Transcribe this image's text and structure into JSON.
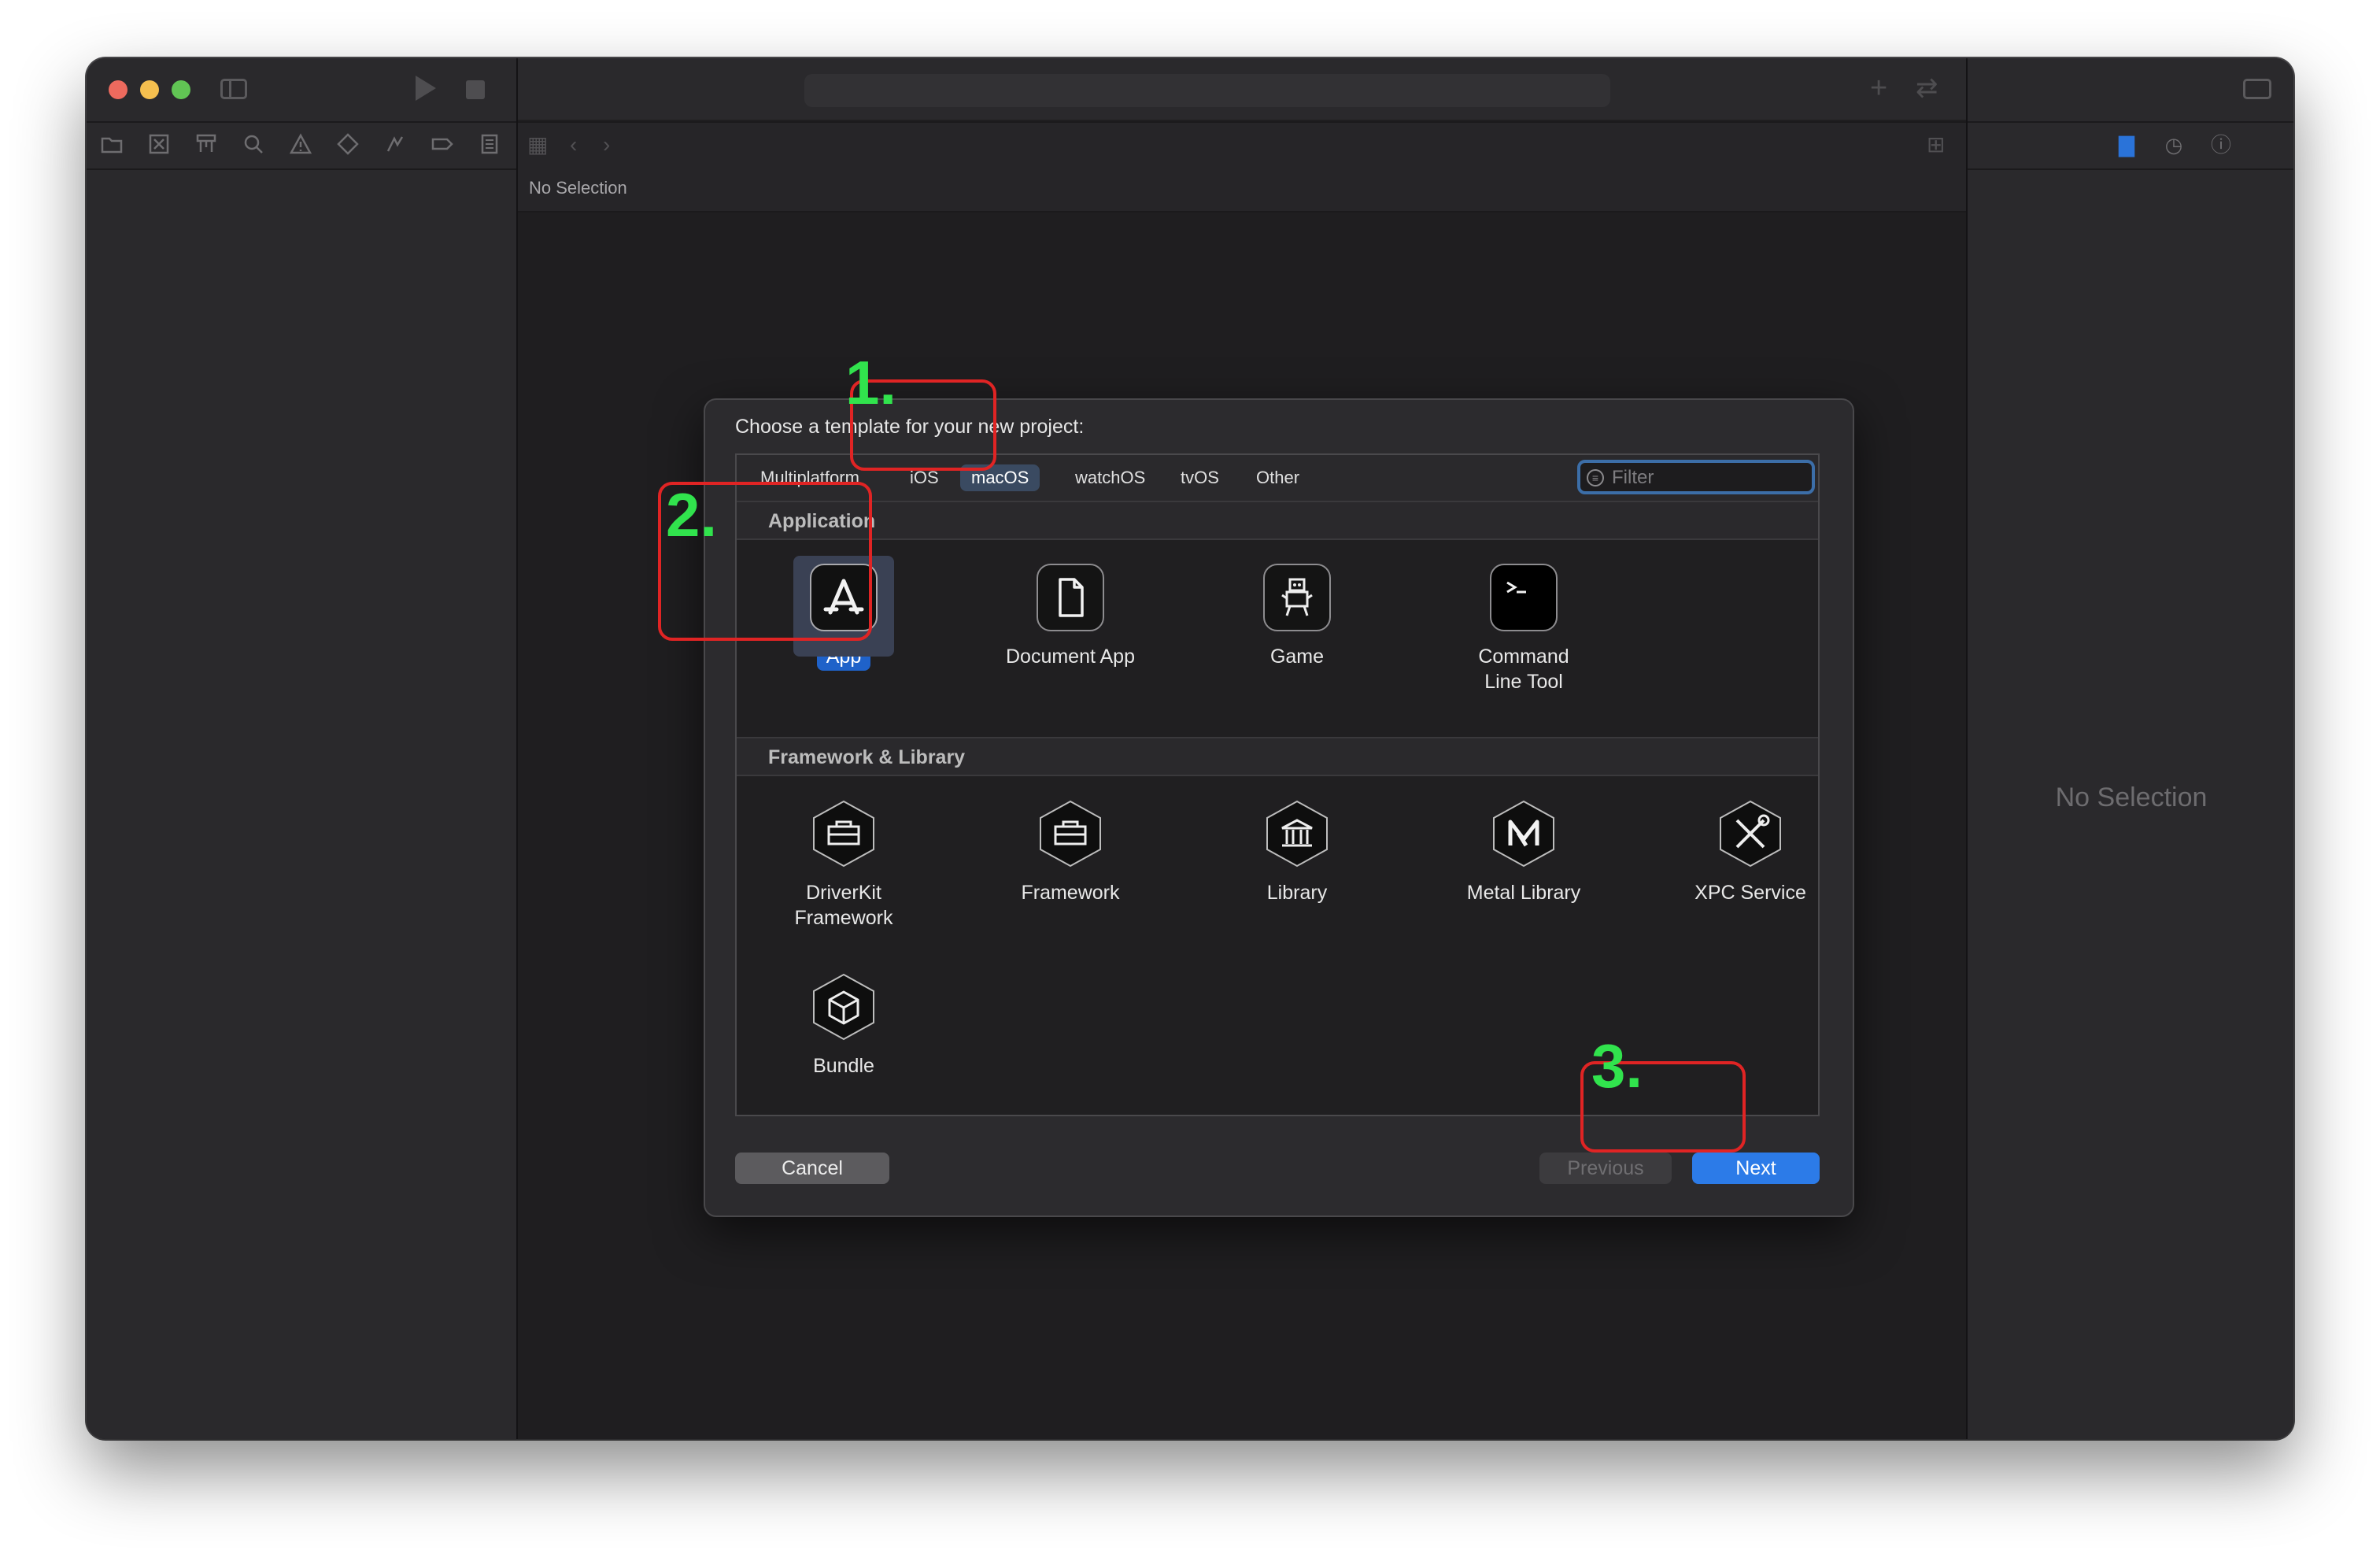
{
  "window": {
    "editor_path": "No Selection",
    "inspector_empty": "No Selection"
  },
  "dialog": {
    "title": "Choose a template for your new project:",
    "tabs": [
      {
        "label": "Multiplatform",
        "active": false
      },
      {
        "label": "iOS",
        "active": false
      },
      {
        "label": "macOS",
        "active": true
      },
      {
        "label": "watchOS",
        "active": false
      },
      {
        "label": "tvOS",
        "active": false
      },
      {
        "label": "Other",
        "active": false
      }
    ],
    "filter_placeholder": "Filter",
    "sections": [
      {
        "header": "Application",
        "templates": [
          {
            "label": "App",
            "icon": "app-store-a-icon",
            "selected": true
          },
          {
            "label": "Document App",
            "icon": "document-icon",
            "selected": false
          },
          {
            "label": "Game",
            "icon": "game-robot-icon",
            "selected": false
          },
          {
            "label": "Command\nLine Tool",
            "icon": "terminal-icon",
            "selected": false
          }
        ]
      },
      {
        "header": "Framework & Library",
        "templates": [
          {
            "label": "DriverKit\nFramework",
            "icon": "toolbox-icon"
          },
          {
            "label": "Framework",
            "icon": "toolbox-icon"
          },
          {
            "label": "Library",
            "icon": "building-columns-icon"
          },
          {
            "label": "Metal Library",
            "icon": "metal-m-icon"
          },
          {
            "label": "XPC Service",
            "icon": "wrench-screwdriver-icon"
          },
          {
            "label": "Bundle",
            "icon": "cube-icon"
          }
        ]
      }
    ],
    "buttons": {
      "cancel": "Cancel",
      "previous": "Previous",
      "next": "Next"
    }
  },
  "annotations": [
    {
      "number": "1.",
      "target": "macOS tab"
    },
    {
      "number": "2.",
      "target": "App template"
    },
    {
      "number": "3.",
      "target": "Next button"
    }
  ],
  "colors": {
    "accent": "#2c7be8",
    "annotation_box": "#e02424",
    "annotation_number": "#31e34d"
  }
}
